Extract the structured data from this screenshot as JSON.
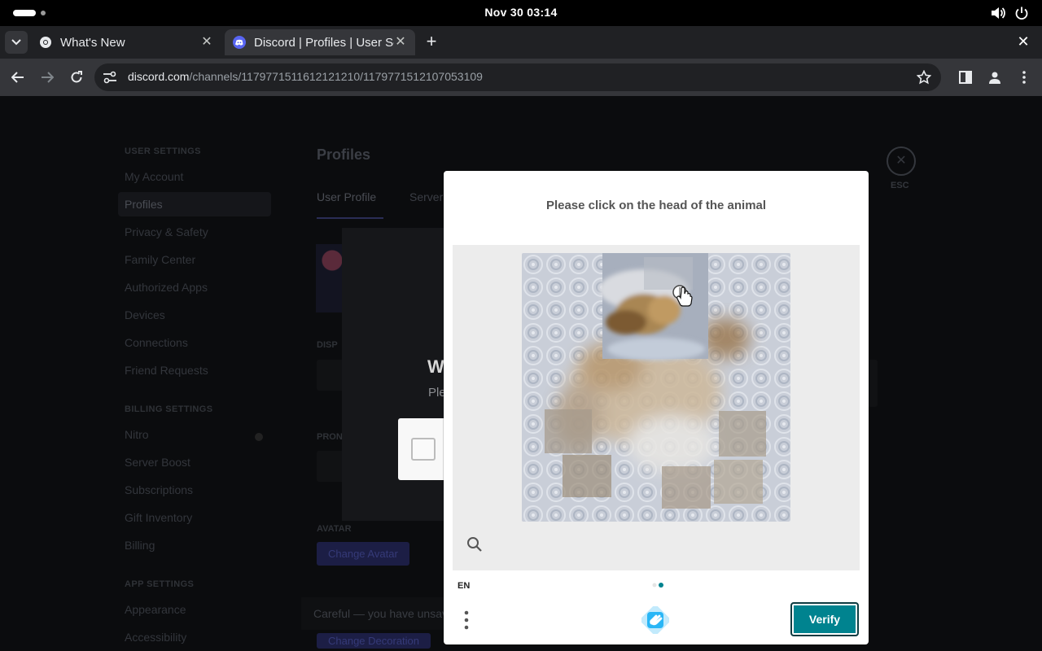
{
  "system": {
    "clock": "Nov 30  03:14"
  },
  "browser": {
    "tabs": [
      {
        "title": "What's New"
      },
      {
        "title": "Discord | Profiles | User Settings"
      }
    ],
    "url_host": "discord.com",
    "url_path": "/channels/1179771511612121210/1179771512107053109"
  },
  "discord": {
    "sidebar": {
      "user_settings_heading": "USER SETTINGS",
      "user_items": [
        "My Account",
        "Profiles",
        "Privacy & Safety",
        "Family Center",
        "Authorized Apps",
        "Devices",
        "Connections",
        "Friend Requests"
      ],
      "billing_heading": "BILLING SETTINGS",
      "billing_items": [
        "Nitro",
        "Server Boost",
        "Subscriptions",
        "Gift Inventory",
        "Billing"
      ],
      "app_heading": "APP SETTINGS",
      "app_items": [
        "Appearance",
        "Accessibility"
      ]
    },
    "page_title": "Profiles",
    "tabs": [
      "User Profile",
      "Server"
    ],
    "esc_label": "ESC",
    "display_label": "DISP",
    "pronouns_label": "PRON",
    "avatar_label": "AVATAR",
    "change_avatar": "Change Avatar",
    "change_decoration": "Change Decoration",
    "warning": "Careful — you have unsaved changes!",
    "bg_modal_title": "W",
    "bg_modal_text": "Ple"
  },
  "captcha": {
    "prompt": "Please click on the head of the animal",
    "language": "EN",
    "verify_label": "Verify",
    "accent": "#00838f"
  }
}
